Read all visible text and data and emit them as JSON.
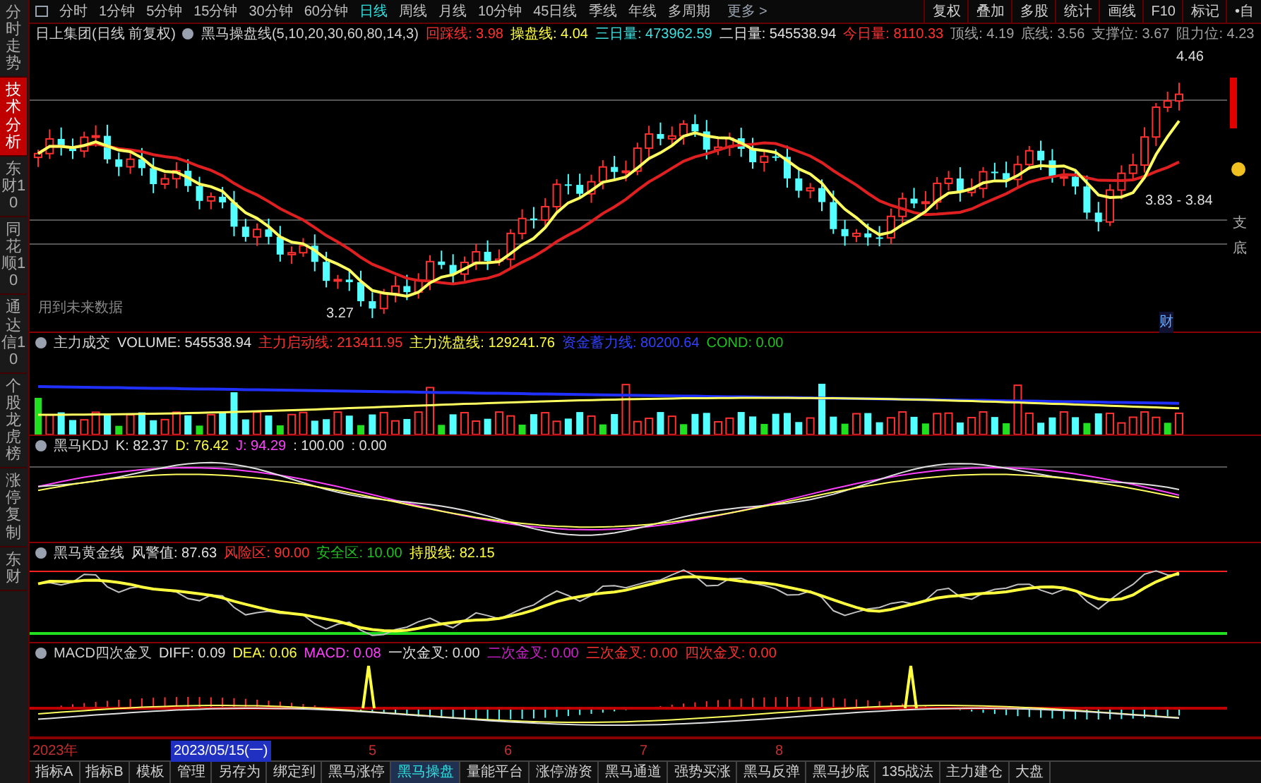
{
  "sidebar_tabs": [
    {
      "label": "分时走势",
      "selected": false
    },
    {
      "label": "技术分析",
      "selected": true
    },
    {
      "label": "东财10",
      "selected": false
    },
    {
      "label": "同花顺10",
      "selected": false
    },
    {
      "label": "通达信10",
      "selected": false
    },
    {
      "label": "个股龙虎榜",
      "selected": false
    },
    {
      "label": "涨停复制",
      "selected": false
    },
    {
      "label": "东财",
      "selected": false
    }
  ],
  "toolbar": {
    "periods": [
      {
        "label": "分时",
        "selected": false
      },
      {
        "label": "1分钟",
        "selected": false
      },
      {
        "label": "5分钟",
        "selected": false
      },
      {
        "label": "15分钟",
        "selected": false
      },
      {
        "label": "30分钟",
        "selected": false
      },
      {
        "label": "60分钟",
        "selected": false
      },
      {
        "label": "日线",
        "selected": true
      },
      {
        "label": "周线",
        "selected": false
      },
      {
        "label": "月线",
        "selected": false
      },
      {
        "label": "10分钟",
        "selected": false
      },
      {
        "label": "45日线",
        "selected": false
      },
      {
        "label": "季线",
        "selected": false
      },
      {
        "label": "年线",
        "selected": false
      },
      {
        "label": "多周期",
        "selected": false
      }
    ],
    "more": "更多 >",
    "buttons": [
      "复权",
      "叠加",
      "多股",
      "统计",
      "画线",
      "F10",
      "标记",
      "•自"
    ]
  },
  "main_panel": {
    "stock": "日上集团(日线 前复权)",
    "indicator": "黑马操盘线(5,10,20,30,60,80,14,3)",
    "values": [
      {
        "text": "回踩线: 3.98",
        "color": "#ff3030"
      },
      {
        "text": "操盘线: 4.04",
        "color": "#ffff40"
      },
      {
        "text": "三日量: 473962.59",
        "color": "#40e0e0"
      },
      {
        "text": "二日量: 545538.94",
        "color": "#e0e0e0"
      },
      {
        "text": "今日量: 8110.33",
        "color": "#ff3030"
      },
      {
        "text": "顶线: 4.19",
        "color": "#a0a0a0"
      },
      {
        "text": "底线: 3.56",
        "color": "#a0a0a0"
      },
      {
        "text": "支撑位: 3.67",
        "color": "#a0a0a0"
      },
      {
        "text": "阻力位: 4.23",
        "color": "#a0a0a0"
      }
    ],
    "high_label": "4.46",
    "low_label": "3.27",
    "range_label": "3.83 - 3.84",
    "future_note": "用到未来数据",
    "right_labels": [
      "支",
      "底"
    ],
    "badge": "财"
  },
  "sub_panels": [
    {
      "kind": "volume",
      "title": "主力成交",
      "values": [
        {
          "text": "VOLUME: 545538.94",
          "color": "#e0e0e0"
        },
        {
          "text": "主力启动线: 213411.95",
          "color": "#ff3030"
        },
        {
          "text": "主力洗盘线: 129241.76",
          "color": "#ffff40"
        },
        {
          "text": "资金蓄力线: 80200.64",
          "color": "#3040ff"
        },
        {
          "text": "COND: 0.00",
          "color": "#20c020"
        }
      ]
    },
    {
      "kind": "kdj",
      "title": "黑马KDJ",
      "values": [
        {
          "text": "K: 82.37",
          "color": "#e0e0e0"
        },
        {
          "text": "D: 76.42",
          "color": "#ffff40"
        },
        {
          "text": "J: 94.29",
          "color": "#ff40ff"
        },
        {
          "text": ": 100.00",
          "color": "#e0e0e0"
        },
        {
          "text": ": 0.00",
          "color": "#e0e0e0"
        }
      ]
    },
    {
      "kind": "gold",
      "title": "黑马黄金线",
      "values": [
        {
          "text": "风警值: 87.63",
          "color": "#e0e0e0"
        },
        {
          "text": "风险区: 90.00",
          "color": "#ff3030"
        },
        {
          "text": "安全区: 10.00",
          "color": "#20c020"
        },
        {
          "text": "持股线: 82.15",
          "color": "#ffff40"
        }
      ]
    },
    {
      "kind": "macd",
      "title": "MACD四次金叉",
      "values": [
        {
          "text": "DIFF: 0.09",
          "color": "#e0e0e0"
        },
        {
          "text": "DEA: 0.06",
          "color": "#ffff40"
        },
        {
          "text": "MACD: 0.08",
          "color": "#ff40ff"
        },
        {
          "text": "一次金叉: 0.00",
          "color": "#e0e0e0"
        },
        {
          "text": "二次金叉: 0.00",
          "color": "#d020d0"
        },
        {
          "text": "三次金叉: 0.00",
          "color": "#ff3030"
        },
        {
          "text": "四次金叉: 0.00",
          "color": "#ff3030"
        }
      ]
    }
  ],
  "date_axis": {
    "year": "2023年",
    "months": [
      "5",
      "6",
      "7",
      "8"
    ],
    "cursor_date": "2023/05/15(一)"
  },
  "bottom_tabs": [
    {
      "label": "指标A",
      "selected": false
    },
    {
      "label": "指标B",
      "selected": false
    },
    {
      "label": "模板",
      "selected": false
    },
    {
      "label": "管理",
      "selected": false
    },
    {
      "label": "另存为",
      "selected": false
    },
    {
      "label": "绑定到",
      "selected": false
    },
    {
      "label": "黑马涨停",
      "selected": false
    },
    {
      "label": "黑马操盘",
      "selected": true
    },
    {
      "label": "量能平台",
      "selected": false
    },
    {
      "label": "涨停游资",
      "selected": false
    },
    {
      "label": "黑马通道",
      "selected": false
    },
    {
      "label": "强势买涨",
      "selected": false
    },
    {
      "label": "黑马反弹",
      "selected": false
    },
    {
      "label": "黑马抄底",
      "selected": false
    },
    {
      "label": "135战法",
      "selected": false
    },
    {
      "label": "主力建仓",
      "selected": false
    },
    {
      "label": "大盘",
      "selected": false
    }
  ]
}
